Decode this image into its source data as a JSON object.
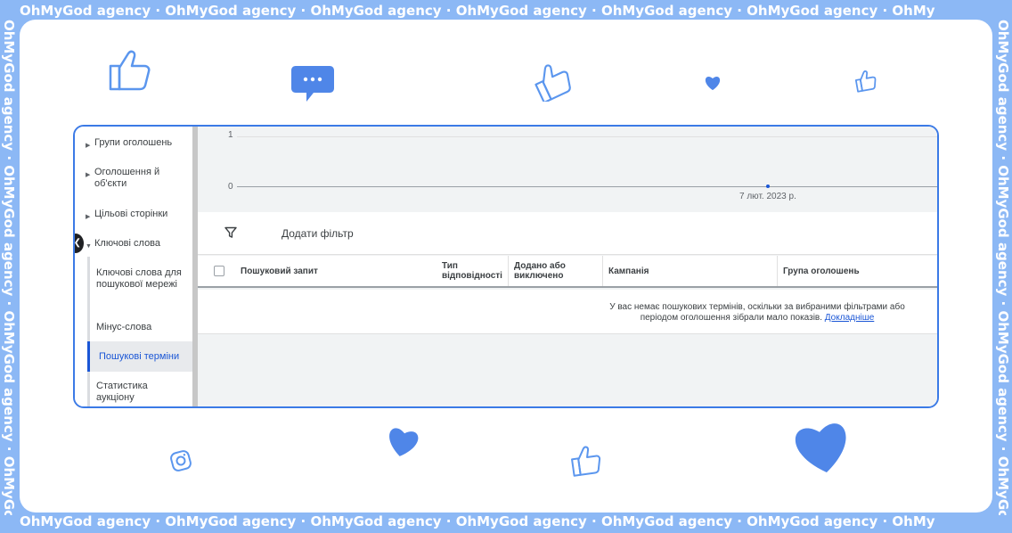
{
  "frame": {
    "border_text": "OhMyGod agency · OhMyGod agency · OhMyGod agency · OhMyGod agency · OhMyGod agency · OhMyGod agency · OhMy",
    "accent_color": "#8cb8f5",
    "frame_color": "#3b7ae6"
  },
  "sidebar": {
    "items": [
      {
        "label": "Групи оголошень"
      },
      {
        "label": "Оголошення й об'єкти"
      },
      {
        "label": "Цільові сторінки"
      },
      {
        "label": "Ключові слова"
      }
    ],
    "sub_items": [
      {
        "label": "Ключові слова для пошукової мережі"
      },
      {
        "label": "Мінус-слова"
      },
      {
        "label": "Пошукові терміни"
      },
      {
        "label": "Статистика аукціону"
      }
    ]
  },
  "chart_data": {
    "type": "line",
    "x": [
      "7 лют. 2023 р."
    ],
    "series": [
      {
        "values": [
          0
        ]
      }
    ],
    "ylim": [
      0,
      1
    ],
    "y_ticks": [
      "1",
      "0"
    ],
    "x_tick_label": "7 лют. 2023 р."
  },
  "filter": {
    "add_filter_label": "Додати фільтр"
  },
  "table": {
    "columns": [
      {
        "label": "Пошуковий запит"
      },
      {
        "label": "Тип відповідності"
      },
      {
        "label": "Додано або виключено"
      },
      {
        "label": "Кампанія"
      },
      {
        "label": "Група оголошень"
      }
    ],
    "empty_message": "У вас немає пошукових термінів, оскільки за вибраними фільтрами або періодом оголошення зібрали мало показів.",
    "learn_more_label": "Докладніше"
  }
}
